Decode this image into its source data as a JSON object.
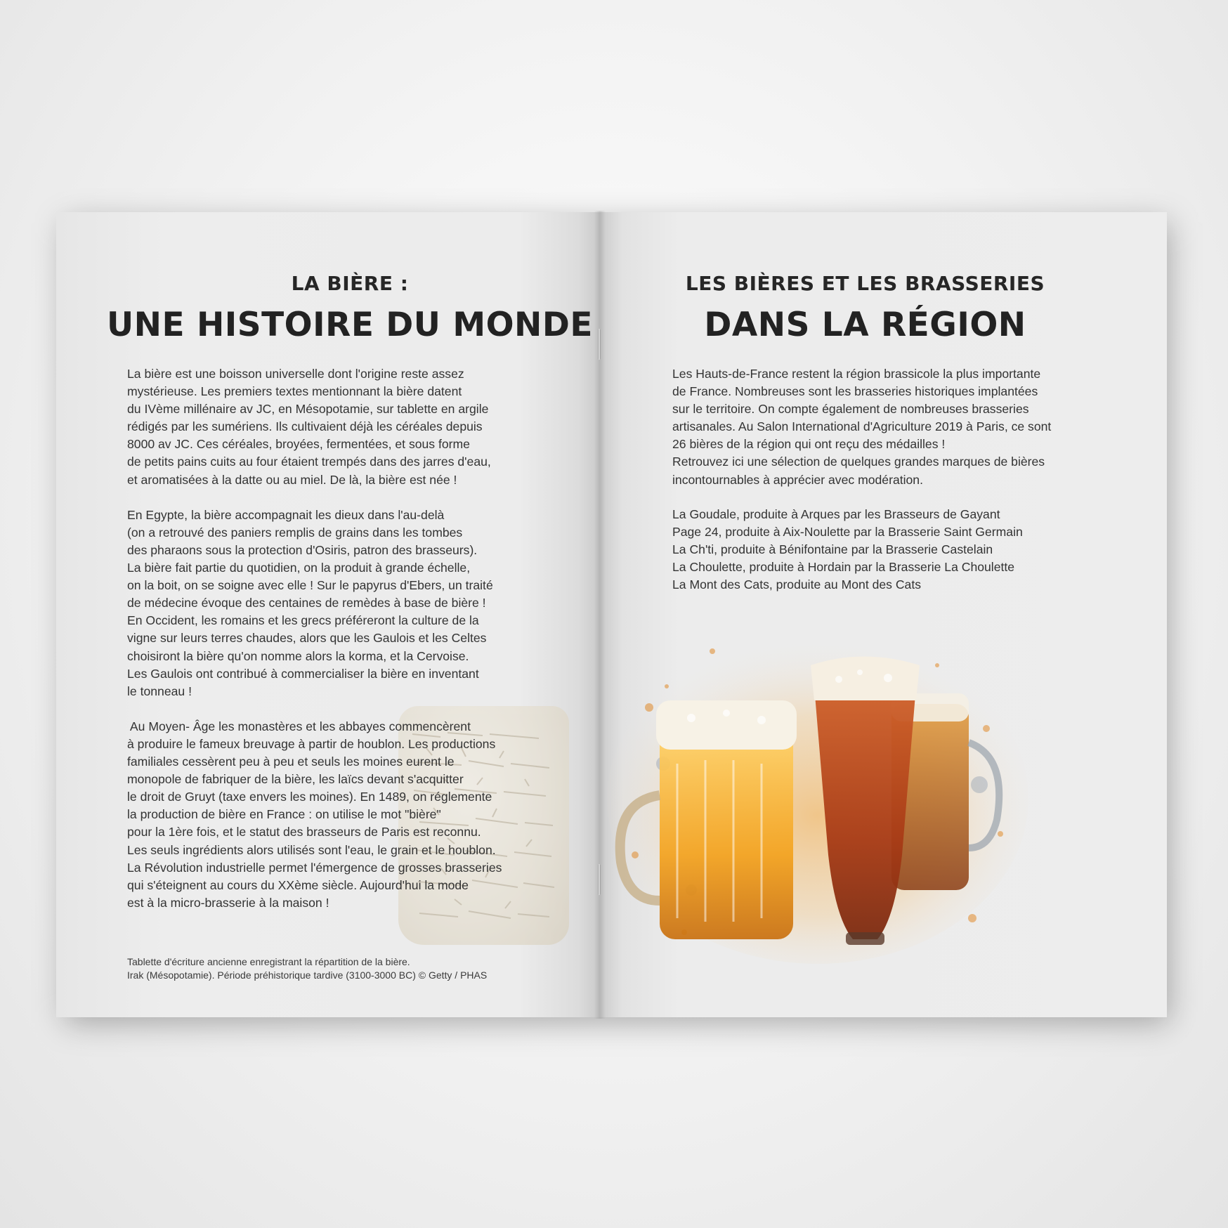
{
  "left_page": {
    "title_small": "LA BIÈRE :",
    "title_big": "UNE HISTOIRE DU MONDE",
    "body": "La bière est une boisson universelle dont l'origine reste assez\nmystérieuse. Les premiers textes mentionnant la bière datent\ndu IVème millénaire av JC, en Mésopotamie, sur tablette en argile\nrédigés par les sumériens. Ils cultivaient déjà les céréales depuis\n8000 av JC. Ces céréales, broyées, fermentées, et sous forme\nde petits pains cuits au four étaient trempés dans des jarres d'eau,\net aromatisées à la datte ou au miel. De là, la bière est née !\n\nEn Egypte, la bière accompagnait les dieux dans l'au-delà\n(on a retrouvé des paniers remplis de grains dans les tombes\ndes pharaons sous la protection d'Osiris, patron des brasseurs).\nLa bière fait partie du quotidien, on la produit à grande échelle,\non la boit, on se soigne avec elle ! Sur le papyrus d'Ebers, un traité\nde médecine évoque des centaines de remèdes à base de bière !\nEn Occident, les romains et les grecs préféreront la culture de la\nvigne sur leurs terres chaudes, alors que les Gaulois et les Celtes\nchoisiront la bière qu'on nomme alors la korma, et la Cervoise.\nLes Gaulois ont contribué à commercialiser la bière en inventant\nle tonneau !\n\n Au Moyen- Âge les monastères et les abbayes commencèrent\nà produire le fameux breuvage à partir de houblon. Les productions\nfamiliales cessèrent peu à peu et seuls les moines eurent le\nmonopole de fabriquer de la bière, les laïcs devant s'acquitter\nle droit de Gruyt (taxe envers les moines). En 1489, on réglemente\nla production de bière en France : on utilise le mot \"bière\"\npour la 1ère fois, et le statut des brasseurs de Paris est reconnu.\nLes seuls ingrédients alors utilisés sont l'eau, le grain et le houblon.\nLa Révolution industrielle permet l'émergence de grosses brasseries\nqui s'éteignent au cours du XXème siècle. Aujourd'hui la mode\nest à la micro-brasserie à la maison !",
    "caption": "Tablette d'écriture ancienne enregistrant la répartition de la bière.\nIrak (Mésopotamie). Période préhistorique tardive (3100-3000 BC) © Getty / PHAS"
  },
  "right_page": {
    "title_small": "LES BIÈRES ET LES BRASSERIES",
    "title_big": "DANS LA RÉGION",
    "body": "Les Hauts-de-France restent la région brassicole la plus importante\nde France. Nombreuses sont les brasseries historiques implantées\nsur le territoire. On compte également de nombreuses brasseries\nartisanales. Au Salon International d'Agriculture 2019 à Paris, ce sont\n26 bières de la région qui ont reçu des médailles !\nRetrouvez ici une sélection de quelques grandes marques de bières\nincontournables à apprécier avec modération.",
    "beers": [
      "La Goudale, produite à Arques par les Brasseurs de Gayant",
      "Page 24, produite à Aix-Noulette par la Brasserie Saint Germain",
      "La Ch'ti, produite à Bénifontaine par la Brasserie Castelain",
      "La Choulette, produite à Hordain par la Brasserie La Choulette",
      "La Mont des Cats, produite au Mont des Cats"
    ]
  },
  "colors": {
    "background": "#f1f1f1",
    "paper": "#ececec",
    "heading": "#222222",
    "body_text": "#333333",
    "beer_amber": "#f0a020",
    "beer_red": "#b8441c"
  }
}
